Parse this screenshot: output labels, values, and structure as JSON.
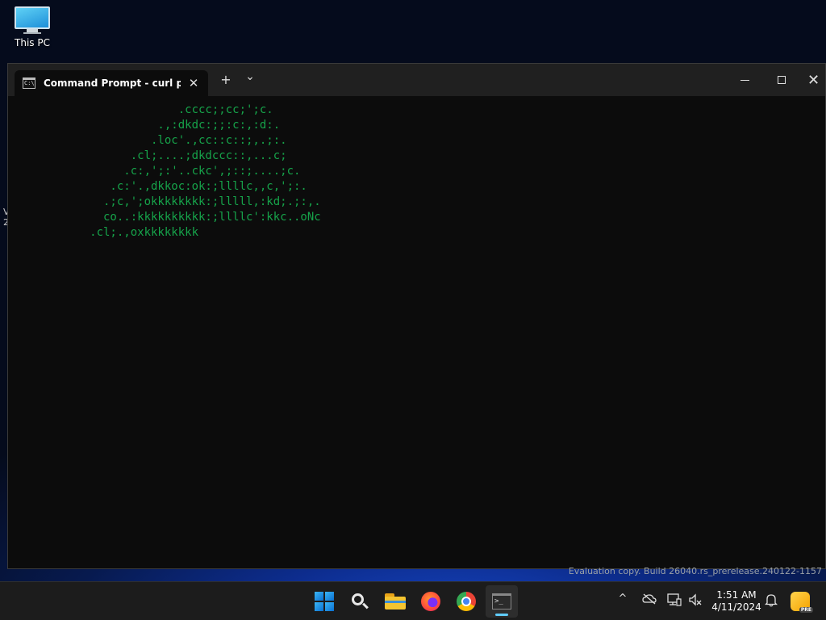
{
  "desktop": {
    "icon_label": "This PC",
    "edge_text_1": "V",
    "edge_text_2": "2"
  },
  "window": {
    "tab_title": "Command Prompt - curl  parr",
    "tab_close": "✕",
    "new_tab": "+",
    "dropdown": "⌄",
    "close_glyph": "✕"
  },
  "terminal": {
    "lines": [
      "                         .cccc;;cc;';c.",
      "                      .,:dkdc:;;:c:,:d:.",
      "                     .loc'.,cc::c::;,.;:.",
      "                  .cl;....;dkdccc::,...c;",
      "                 .c:,';:'..ckc',;::;....;c.",
      "               .c:'.,dkkoc:ok:;llllc,,c,';:.",
      "              .;c,';okkkkkkkk:;lllll,:kd;.;:,.",
      "              co..:kkkkkkkkkk:;llllc':kkc..oNc",
      "            .cl;.,oxkkkkkkkk"
    ],
    "text_color": "#16a34a"
  },
  "watermark": "Evaluation copy. Build 26040.rs_prerelease.240122-1157",
  "taskbar": {
    "terminal_glyph": ">_",
    "tray_chevron": "^",
    "clock_time": "1:51 AM",
    "clock_date": "4/11/2024",
    "pre_badge": "PRE",
    "accent": "#60cdff"
  }
}
